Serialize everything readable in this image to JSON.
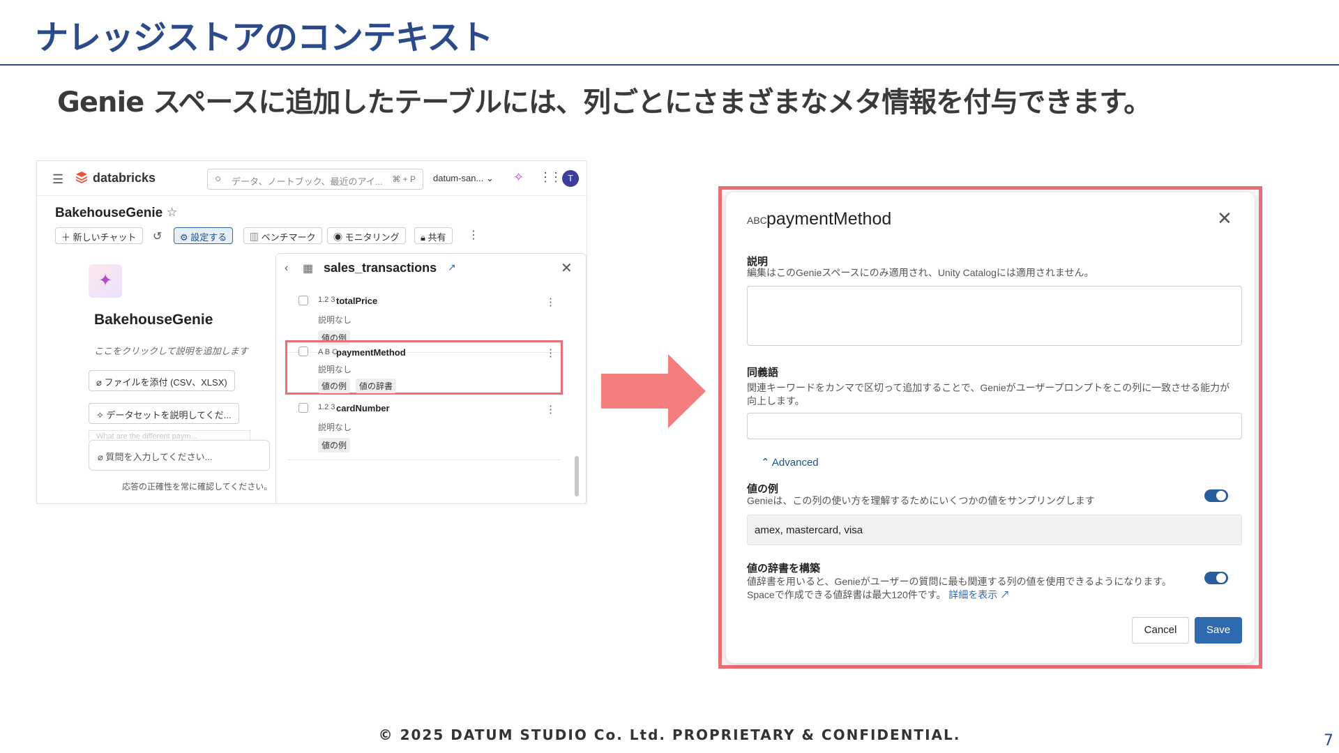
{
  "slide": {
    "title": "ナレッジストアのコンテキスト",
    "subtitle": "Genie スペースに追加したテーブルには、列ごとにさまざまなメタ情報を付与できます。",
    "footer": "© 2025 DATUM STUDIO Co. Ltd. PROPRIETARY & CONFIDENTIAL.",
    "page_number": "7"
  },
  "app": {
    "logo": "databricks",
    "search_placeholder": "データ、ノートブック、最近のアイ...",
    "search_shortcut": "⌘ + P",
    "workspace": "datum-san...",
    "avatar_initial": "T",
    "space_title": "BakehouseGenie",
    "toolbar": {
      "new_chat": "新しいチャット",
      "configure": "設定する",
      "benchmark": "ベンチマーク",
      "monitoring": "モニタリング",
      "share": "共有"
    },
    "genie": {
      "name": "BakehouseGenie",
      "description_placeholder": "ここをクリックして説明を追加します",
      "attach_button": "ファイルを添付 (CSV、XLSX)",
      "explain_button": "データセットを説明してくだ...",
      "suggestion_faded": "What are the different paym...",
      "ask_placeholder": "質問を入力してください...",
      "disclaimer": "応答の正確性を常に確認してください。"
    },
    "panel": {
      "table_name": "sales_transactions",
      "columns": [
        {
          "type": "1.2 3",
          "name": "totalPrice",
          "description": "説明なし",
          "tags": [
            "値の例"
          ]
        },
        {
          "type": "A B C",
          "name": "paymentMethod",
          "description": "説明なし",
          "tags": [
            "値の例",
            "値の辞書"
          ]
        },
        {
          "type": "1.2 3",
          "name": "cardNumber",
          "description": "説明なし",
          "tags": [
            "値の例"
          ]
        }
      ]
    }
  },
  "dialog": {
    "type_icon": "ABC",
    "title": "paymentMethod",
    "description_label": "説明",
    "description_help": "編集はこのGenieスペースにのみ適用され、Unity Catalogには適用されません。",
    "synonyms_label": "同義語",
    "synonyms_help": "関連キーワードをカンマで区切って追加することで、Genieがユーザープロンプトをこの列に一致させる能力が向上します。",
    "advanced_label": "Advanced",
    "sample_values_label": "値の例",
    "sample_values_help": "Genieは、この列の使い方を理解するためにいくつかの値をサンプリングします",
    "sample_values_enabled": true,
    "sample_values": "amex, mastercard, visa",
    "dictionary_label": "値の辞書を構築",
    "dictionary_help_1": "値辞書を用いると、Genieがユーザーの質問に最も関連する列の値を使用できるようになります。",
    "dictionary_help_2": "Spaceで作成できる値辞書は最大120件です。",
    "dictionary_link": "詳細を表示",
    "dictionary_enabled": true,
    "cancel_button": "Cancel",
    "save_button": "Save"
  },
  "colors": {
    "title_blue": "#2b4a8a",
    "highlight_red": "#ea6f73",
    "primary_blue": "#2f6ab0"
  }
}
